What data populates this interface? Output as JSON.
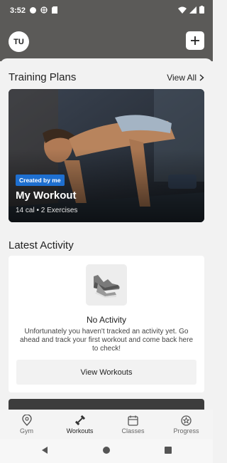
{
  "status_bar": {
    "time": "3:52"
  },
  "header": {
    "avatar_initials": "TU"
  },
  "training_plans": {
    "title": "Training Plans",
    "view_all_label": "View All",
    "card": {
      "tag": "Created by me",
      "name": "My Workout",
      "meta": "14 cal • 2 Exercises"
    }
  },
  "latest_activity": {
    "title": "Latest Activity",
    "empty_title": "No Activity",
    "empty_description": "Unfortunately you haven't tracked an activity yet. Go ahead and track your first workout and come back here to check!",
    "button_label": "View Workouts"
  },
  "tabs": [
    {
      "label": "Gym",
      "icon": "location-pin-icon",
      "active": false
    },
    {
      "label": "Workouts",
      "icon": "dumbbell-icon",
      "active": true
    },
    {
      "label": "Classes",
      "icon": "calendar-icon",
      "active": false
    },
    {
      "label": "Progress",
      "icon": "star-badge-icon",
      "active": false
    }
  ],
  "colors": {
    "header_bg": "#5b5a58",
    "tag_blue": "#1e6fd0",
    "background": "#f2f2f2"
  }
}
